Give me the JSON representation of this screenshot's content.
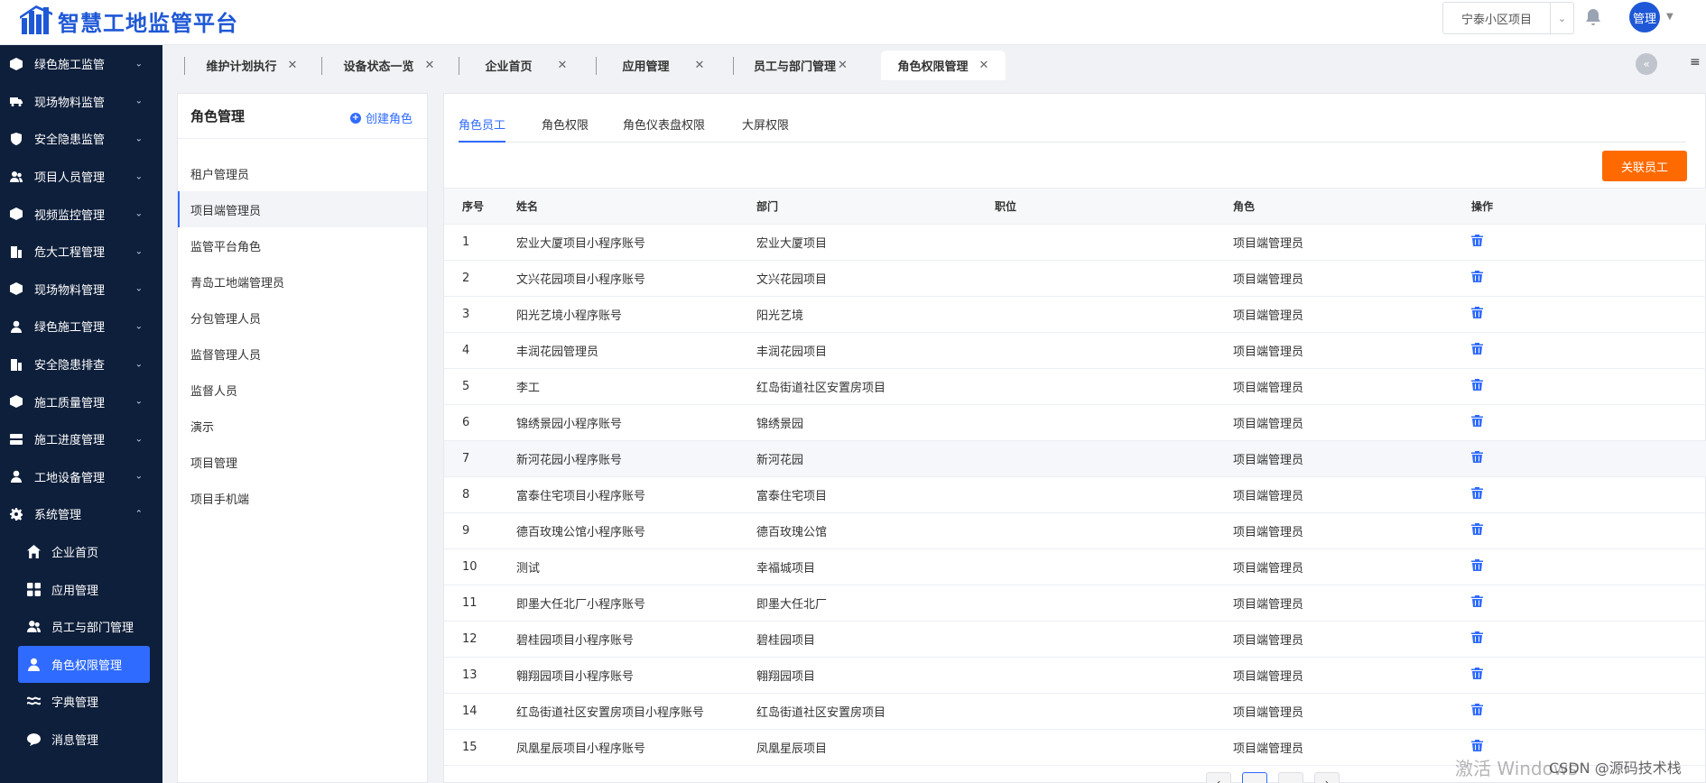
{
  "header": {
    "app_title": "智慧工地监管平台",
    "project_select": "宁泰小区项目",
    "avatar_label": "管理"
  },
  "sidebar": {
    "items": [
      {
        "label": "绿色施工监管",
        "icon": "cube-icon"
      },
      {
        "label": "现场物料监管",
        "icon": "truck-icon"
      },
      {
        "label": "安全隐患监管",
        "icon": "shield-icon"
      },
      {
        "label": "项目人员管理",
        "icon": "users-icon"
      },
      {
        "label": "视频监控管理",
        "icon": "cube-icon"
      },
      {
        "label": "危大工程管理",
        "icon": "building-icon"
      },
      {
        "label": "现场物料管理",
        "icon": "cube-icon"
      },
      {
        "label": "绿色施工管理",
        "icon": "user-icon"
      },
      {
        "label": "安全隐患排查",
        "icon": "building-icon"
      },
      {
        "label": "施工质量管理",
        "icon": "cube-icon"
      },
      {
        "label": "施工进度管理",
        "icon": "server-icon"
      },
      {
        "label": "工地设备管理",
        "icon": "user-icon"
      },
      {
        "label": "系统管理",
        "icon": "gear-icon"
      }
    ],
    "sub_items": [
      {
        "label": "企业首页",
        "icon": "home-icon"
      },
      {
        "label": "应用管理",
        "icon": "grid-icon"
      },
      {
        "label": "员工与部门管理",
        "icon": "users-icon"
      },
      {
        "label": "角色权限管理",
        "icon": "user-icon"
      },
      {
        "label": "字典管理",
        "icon": "layers-icon"
      },
      {
        "label": "消息管理",
        "icon": "message-icon"
      }
    ]
  },
  "tabs": [
    {
      "label": "维护计划执行"
    },
    {
      "label": "设备状态一览"
    },
    {
      "label": "企业首页"
    },
    {
      "label": "应用管理"
    },
    {
      "label": "员工与部门管理"
    },
    {
      "label": "角色权限管理"
    }
  ],
  "role_panel": {
    "title": "角色管理",
    "create_label": "创建角色",
    "roles": [
      "租户管理员",
      "项目端管理员",
      "监管平台角色",
      "青岛工地端管理员",
      "分包管理人员",
      "监督管理人员",
      "监督人员",
      "演示",
      "项目管理",
      "项目手机端"
    ]
  },
  "main": {
    "subtabs": [
      "角色员工",
      "角色权限",
      "角色仪表盘权限",
      "大屏权限"
    ],
    "link_button": "关联员工",
    "columns": [
      "序号",
      "姓名",
      "部门",
      "职位",
      "角色",
      "操作"
    ],
    "rows": [
      {
        "no": "1",
        "name": "宏业大厦项目小程序账号",
        "dept": "宏业大厦项目",
        "pos": "",
        "role": "项目端管理员"
      },
      {
        "no": "2",
        "name": "文兴花园项目小程序账号",
        "dept": "文兴花园项目",
        "pos": "",
        "role": "项目端管理员"
      },
      {
        "no": "3",
        "name": "阳光艺境小程序账号",
        "dept": "阳光艺境",
        "pos": "",
        "role": "项目端管理员"
      },
      {
        "no": "4",
        "name": "丰润花园管理员",
        "dept": "丰润花园项目",
        "pos": "",
        "role": "项目端管理员"
      },
      {
        "no": "5",
        "name": "李工",
        "dept": "红岛街道社区安置房项目",
        "pos": "",
        "role": "项目端管理员"
      },
      {
        "no": "6",
        "name": "锦绣景园小程序账号",
        "dept": "锦绣景园",
        "pos": "",
        "role": "项目端管理员"
      },
      {
        "no": "7",
        "name": "新河花园小程序账号",
        "dept": "新河花园",
        "pos": "",
        "role": "项目端管理员"
      },
      {
        "no": "8",
        "name": "富泰住宅项目小程序账号",
        "dept": "富泰住宅项目",
        "pos": "",
        "role": "项目端管理员"
      },
      {
        "no": "9",
        "name": "德百玫瑰公馆小程序账号",
        "dept": "德百玫瑰公馆",
        "pos": "",
        "role": "项目端管理员"
      },
      {
        "no": "10",
        "name": "测试",
        "dept": "幸福城项目",
        "pos": "",
        "role": "项目端管理员"
      },
      {
        "no": "11",
        "name": "即墨大任北厂小程序账号",
        "dept": "即墨大任北厂",
        "pos": "",
        "role": "项目端管理员"
      },
      {
        "no": "12",
        "name": "碧桂园项目小程序账号",
        "dept": "碧桂园项目",
        "pos": "",
        "role": "项目端管理员"
      },
      {
        "no": "13",
        "name": "翱翔园项目小程序账号",
        "dept": "翱翔园项目",
        "pos": "",
        "role": "项目端管理员"
      },
      {
        "no": "14",
        "name": "红岛街道社区安置房项目小程序账号",
        "dept": "红岛街道社区安置房项目",
        "pos": "",
        "role": "项目端管理员"
      },
      {
        "no": "15",
        "name": "凤凰星辰项目小程序账号",
        "dept": "凤凰星辰项目",
        "pos": "",
        "role": "项目端管理员"
      }
    ]
  },
  "overlay": {
    "watermark": "激活 Windows",
    "csdn": "CSDN @源码技术栈"
  },
  "colors": {
    "brand": "#1f58d6",
    "sidebar_bg": "#0e1f3b",
    "active": "#2f6bff",
    "action": "#ff6a00"
  }
}
